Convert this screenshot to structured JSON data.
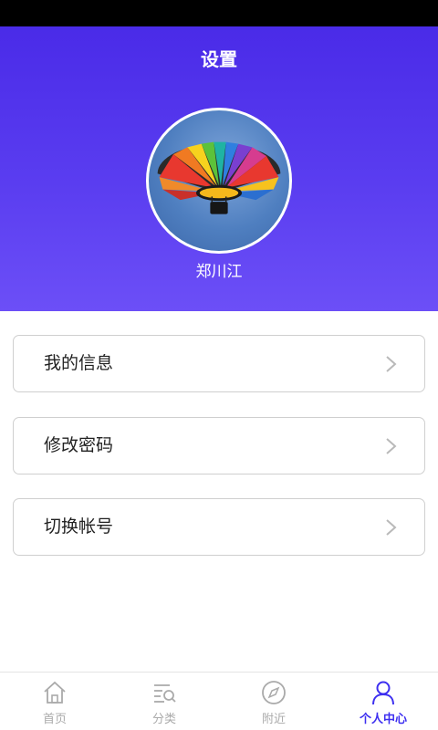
{
  "header": {
    "title": "设置",
    "username": "郑川江",
    "avatar_icon": "hot-air-balloon-photo"
  },
  "menu": {
    "items": [
      {
        "label": "我的信息",
        "icon": "chevron-right-icon"
      },
      {
        "label": "修改密码",
        "icon": "chevron-right-icon"
      },
      {
        "label": "切换帐号",
        "icon": "chevron-right-icon"
      }
    ]
  },
  "bottom_nav": {
    "items": [
      {
        "label": "首页",
        "icon": "home-icon",
        "active": false
      },
      {
        "label": "分类",
        "icon": "category-search-icon",
        "active": false
      },
      {
        "label": "附近",
        "icon": "compass-icon",
        "active": false
      },
      {
        "label": "个人中心",
        "icon": "person-icon",
        "active": true
      }
    ]
  },
  "colors": {
    "accent": "#3d2ff0",
    "header_top": "#4a2be8",
    "header_bottom": "#6c4ff7",
    "inactive_nav": "#aaaaaa"
  }
}
